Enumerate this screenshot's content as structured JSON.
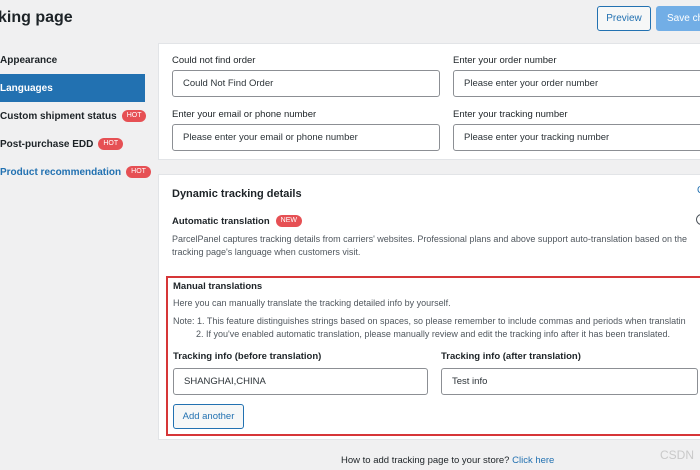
{
  "header": {
    "title": "king page",
    "preview_label": "Preview",
    "save_label": "Save cha"
  },
  "sidebar": {
    "items": [
      {
        "label": "Appearance"
      },
      {
        "label": "Languages"
      },
      {
        "label": "Custom shipment status",
        "badge": "HOT"
      },
      {
        "label": "Post-purchase EDD",
        "badge": "HOT"
      },
      {
        "label": "Product recommendation",
        "badge": "HOT"
      }
    ]
  },
  "fields": {
    "not_found": {
      "label": "Could not find order",
      "value": "Could Not Find Order"
    },
    "order_number": {
      "label": "Enter your order number",
      "value": "Please enter your order number"
    },
    "email_phone": {
      "label": "Enter your email or phone number",
      "value": "Please enter your email or phone number"
    },
    "tracking_number": {
      "label": "Enter your tracking number",
      "value": "Please enter your tracking number"
    }
  },
  "dynamic": {
    "title": "Dynamic tracking details",
    "corner_link": "C",
    "auto_title": "Automatic translation",
    "auto_badge": "NEW",
    "auto_desc": "ParcelPanel captures tracking details from carriers' websites. Professional plans and above support auto-translation based on the tracking page's language when customers visit."
  },
  "manual": {
    "title": "Manual translations",
    "desc": "Here you can manually translate the tracking detailed info by yourself.",
    "note1": "Note: 1. This feature distinguishes strings based on spaces, so please remember to include commas and periods when translatin",
    "note2": "2. If you've enabled automatic translation, please manually review and edit the tracking info after it has been translated.",
    "before_label": "Tracking info (before translation)",
    "before_value": "SHANGHAI,CHINA",
    "after_label": "Tracking info (after translation)",
    "after_value": "Test info",
    "add_label": "Add another"
  },
  "footer": {
    "text": "How to add tracking page to your store?",
    "link": "Click here"
  },
  "watermark": "CSDN"
}
